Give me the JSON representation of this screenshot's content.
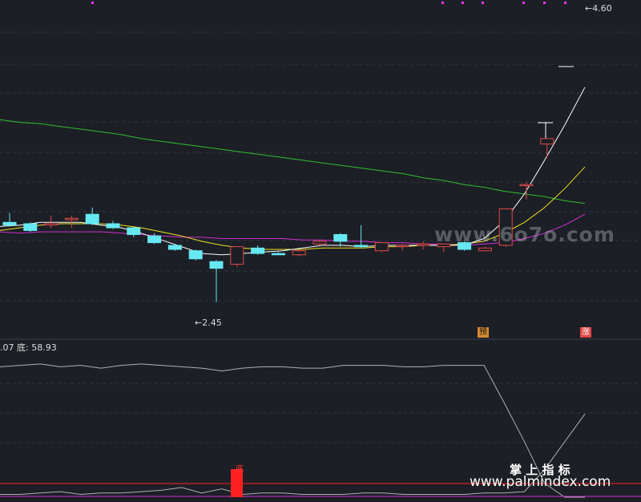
{
  "indicator": {
    "prefix": ".07",
    "name": "底",
    "value": "58.93"
  },
  "annotations": {
    "high": "4.60",
    "low": "2.45"
  },
  "badges": {
    "pre": "预",
    "rise": "涨"
  },
  "bottom_signal": "底",
  "watermark": "www.6o7o.com",
  "footer": {
    "title": "掌 上 指 标",
    "url": "www.palmindex.com"
  },
  "colors": {
    "background": "#1c1f26",
    "up": "#e04848",
    "down": "#66e8f2",
    "ma_fast": "#ffffff",
    "ma_mid": "#f0e020",
    "ma_slow": "#d030d0",
    "ma_long": "#30c030",
    "signal": "#ff2020"
  },
  "chart_data": [
    {
      "type": "candlestick",
      "title": "",
      "y_range": [
        2.3,
        4.65
      ],
      "candles": [
        {
          "o": 3.04,
          "h": 3.11,
          "l": 3.01,
          "c": 3.02
        },
        {
          "o": 3.03,
          "h": 3.04,
          "l": 2.97,
          "c": 2.98
        },
        {
          "o": 3.02,
          "h": 3.09,
          "l": 3.0,
          "c": 3.03
        },
        {
          "o": 3.06,
          "h": 3.09,
          "l": 3.0,
          "c": 3.07
        },
        {
          "o": 3.1,
          "h": 3.15,
          "l": 3.02,
          "c": 3.03
        },
        {
          "o": 3.03,
          "h": 3.05,
          "l": 2.99,
          "c": 3.0
        },
        {
          "o": 3.0,
          "h": 3.01,
          "l": 2.93,
          "c": 2.95
        },
        {
          "o": 2.94,
          "h": 2.96,
          "l": 2.88,
          "c": 2.89
        },
        {
          "o": 2.87,
          "h": 2.88,
          "l": 2.83,
          "c": 2.84
        },
        {
          "o": 2.83,
          "h": 2.84,
          "l": 2.76,
          "c": 2.77
        },
        {
          "o": 2.75,
          "h": 2.76,
          "l": 2.45,
          "c": 2.7
        },
        {
          "o": 2.73,
          "h": 2.86,
          "l": 2.71,
          "c": 2.86
        },
        {
          "o": 2.85,
          "h": 2.87,
          "l": 2.8,
          "c": 2.81
        },
        {
          "o": 2.81,
          "h": 2.82,
          "l": 2.8,
          "c": 2.8
        },
        {
          "o": 2.8,
          "h": 2.84,
          "l": 2.79,
          "c": 2.83
        },
        {
          "o": 2.88,
          "h": 2.91,
          "l": 2.87,
          "c": 2.9
        },
        {
          "o": 2.95,
          "h": 2.96,
          "l": 2.86,
          "c": 2.9
        },
        {
          "o": 2.87,
          "h": 3.02,
          "l": 2.85,
          "c": 2.86
        },
        {
          "o": 2.83,
          "h": 2.89,
          "l": 2.82,
          "c": 2.89
        },
        {
          "o": 2.87,
          "h": 2.88,
          "l": 2.83,
          "c": 2.87
        },
        {
          "o": 2.87,
          "h": 2.9,
          "l": 2.84,
          "c": 2.88
        },
        {
          "o": 2.86,
          "h": 2.88,
          "l": 2.82,
          "c": 2.88
        },
        {
          "o": 2.89,
          "h": 2.9,
          "l": 2.83,
          "c": 2.84
        },
        {
          "o": 2.83,
          "h": 2.86,
          "l": 2.83,
          "c": 2.85
        },
        {
          "o": 2.87,
          "h": 3.14,
          "l": 2.86,
          "c": 3.14
        },
        {
          "o": 3.32,
          "h": 3.34,
          "l": 3.21,
          "c": 3.32
        },
        {
          "o": 3.62,
          "h": 3.66,
          "l": 3.52,
          "c": 3.66
        }
      ],
      "ma_fast": [
        3.01,
        3.02,
        3.04,
        3.04,
        3.04,
        3.02,
        3.0,
        2.96,
        2.91,
        2.86,
        2.81,
        2.8,
        2.81,
        2.82,
        2.83,
        2.85,
        2.87,
        2.87,
        2.86,
        2.87,
        2.87,
        2.87,
        2.87,
        2.87,
        2.92,
        3.05,
        3.25,
        3.5,
        3.76,
        4.04
      ],
      "ma_mid": [
        2.98,
        3.0,
        3.02,
        3.03,
        3.03,
        3.03,
        3.02,
        3.0,
        2.97,
        2.94,
        2.9,
        2.87,
        2.85,
        2.84,
        2.84,
        2.84,
        2.85,
        2.85,
        2.85,
        2.86,
        2.86,
        2.87,
        2.87,
        2.88,
        2.9,
        2.96,
        3.04,
        3.15,
        3.29,
        3.45
      ],
      "ma_slow": [
        2.97,
        2.96,
        2.97,
        2.97,
        2.97,
        2.97,
        2.96,
        2.95,
        2.94,
        2.93,
        2.93,
        2.92,
        2.92,
        2.92,
        2.92,
        2.91,
        2.91,
        2.9,
        2.9,
        2.89,
        2.89,
        2.88,
        2.88,
        2.87,
        2.88,
        2.89,
        2.92,
        2.96,
        3.02,
        3.1
      ],
      "ma_long": [
        3.8,
        3.78,
        3.77,
        3.75,
        3.73,
        3.71,
        3.69,
        3.66,
        3.64,
        3.62,
        3.6,
        3.58,
        3.56,
        3.54,
        3.52,
        3.5,
        3.48,
        3.46,
        3.44,
        3.42,
        3.4,
        3.37,
        3.35,
        3.32,
        3.3,
        3.27,
        3.25,
        3.23,
        3.2,
        3.18
      ]
    },
    {
      "type": "line",
      "title": "",
      "y_range": [
        0,
        100
      ],
      "series": [
        {
          "values": [
            94,
            95,
            96,
            94,
            95,
            93,
            95,
            96,
            95,
            94,
            93,
            91,
            93,
            94,
            94,
            93,
            93,
            95,
            95,
            95,
            94,
            94,
            95,
            95,
            95,
            68,
            40,
            10,
            0,
            0
          ]
        },
        {
          "values": [
            2,
            2,
            3,
            4,
            2,
            3,
            3,
            4,
            5,
            7,
            3,
            6,
            2,
            3,
            3,
            2,
            2,
            2,
            3,
            3,
            2,
            2,
            2,
            2,
            3,
            3,
            4,
            20,
            40,
            60
          ]
        }
      ],
      "signal_bar_index": 11
    }
  ]
}
